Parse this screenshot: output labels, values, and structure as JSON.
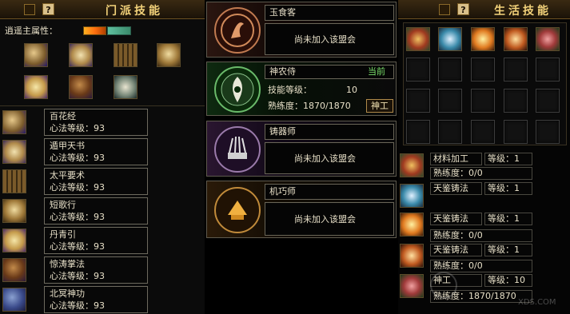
{
  "sect": {
    "title": "门派技能",
    "attr_label": "逍遥主属性：",
    "skills": [
      {
        "name": "百花经",
        "level_label": "心法等级：93"
      },
      {
        "name": "遁甲天书",
        "level_label": "心法等级：93"
      },
      {
        "name": "太平要术",
        "level_label": "心法等级：93"
      },
      {
        "name": "短歌行",
        "level_label": "心法等级：93"
      },
      {
        "name": "丹青引",
        "level_label": "心法等级：93"
      },
      {
        "name": "惊涛掌法",
        "level_label": "心法等级：93"
      },
      {
        "name": "北冥神功",
        "level_label": "心法等级：93"
      }
    ]
  },
  "guilds": [
    {
      "name": "玉食客",
      "status": "尚未加入该盟会"
    },
    {
      "name": "神农侍",
      "tag": "当前",
      "level_label": "技能等级：",
      "level_value": "10",
      "prof_label": "熟练度：1870/1870",
      "button": "神工"
    },
    {
      "name": "铸器师",
      "status": "尚未加入该盟会"
    },
    {
      "name": "机巧师",
      "status": "尚未加入该盟会"
    }
  ],
  "life": {
    "title": "生活技能",
    "rows": [
      {
        "name": "材料加工",
        "level": "等级：1",
        "prof": "熟练度：0/0"
      },
      {
        "name": "天鉴铸法",
        "level": "等级：1"
      },
      {
        "name": "天鉴铸法",
        "level": "等级：1",
        "prof": "熟练度：0/0"
      },
      {
        "name": "天鉴铸法",
        "level": "等级：1",
        "prof": "熟练度：0/0"
      },
      {
        "name": "神工",
        "level": "等级：10",
        "prof": "熟练度：1870/1870"
      }
    ]
  },
  "watermark": "XDS.COM"
}
